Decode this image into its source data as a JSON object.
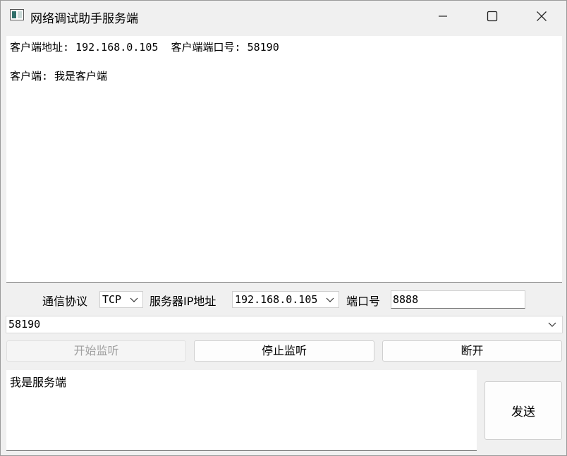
{
  "window": {
    "title": "网络调试助手服务端"
  },
  "receive_log": {
    "lines": [
      "客户端地址: 192.168.0.105  客户端端口号: 58190",
      "客户端: 我是客户端"
    ]
  },
  "settings": {
    "protocol_label": "通信协议",
    "protocol_value": "TCP",
    "server_ip_label": "服务器IP地址",
    "server_ip_value": "192.168.0.105",
    "port_label": "端口号",
    "port_value": "8888"
  },
  "client_select": {
    "value": "58190"
  },
  "buttons": {
    "start_listen": "开始监听",
    "stop_listen": "停止监听",
    "disconnect": "断开",
    "send": "发送"
  },
  "send_box": {
    "value": "我是服务端"
  },
  "icons": {
    "minimize": "minimize-icon",
    "maximize": "maximize-icon",
    "close": "close-icon",
    "chevron": "chevron-down-icon"
  }
}
